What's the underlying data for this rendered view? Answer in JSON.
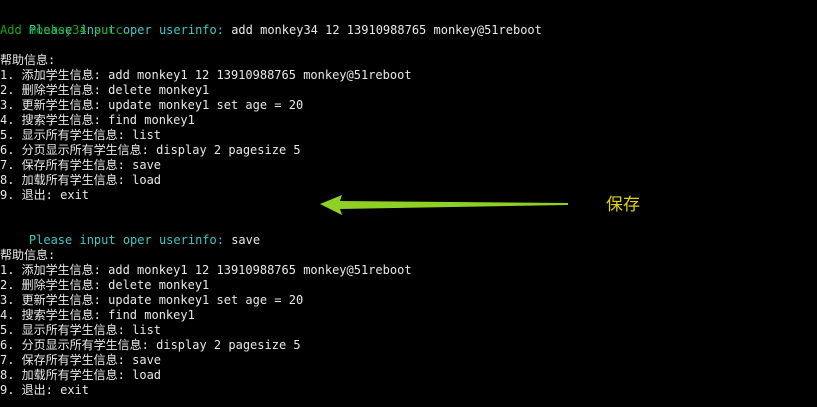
{
  "colors": {
    "background": "#000000",
    "text": "#e8e8e8",
    "prompt": "#3fc7c7",
    "success": "#17a317",
    "annotation": "#e0d500",
    "arrow": "#8ed024"
  },
  "session1": {
    "prompt": "Please input oper userinfo:",
    "command": " add monkey34 12 13910988765 monkey@51reboot",
    "result": "Add monkey34 succ."
  },
  "help_block_1": {
    "header": "帮助信息:",
    "items": [
      "1. 添加学生信息: add monkey1 12 13910988765 monkey@51reboot",
      "2. 删除学生信息: delete monkey1",
      "3. 更新学生信息: update monkey1 set age = 20",
      "4. 搜索学生信息: find monkey1",
      "5. 显示所有学生信息: list",
      "6. 分页显示所有学生信息: display 2 pagesize 5",
      "7. 保存所有学生信息: save",
      "8. 加载所有学生信息: load",
      "9. 退出: exit"
    ]
  },
  "session2": {
    "prompt": "Please input oper userinfo:",
    "command": " save"
  },
  "help_block_2": {
    "header": "帮助信息:",
    "items": [
      "1. 添加学生信息: add monkey1 12 13910988765 monkey@51reboot",
      "2. 删除学生信息: delete monkey1",
      "3. 更新学生信息: update monkey1 set age = 20",
      "4. 搜索学生信息: find monkey1",
      "5. 显示所有学生信息: list",
      "6. 分页显示所有学生信息: display 2 pagesize 5",
      "7. 保存所有学生信息: save",
      "8. 加载所有学生信息: load",
      "9. 退出: exit"
    ]
  },
  "annotation": {
    "label": "保存",
    "icon": "arrow-left-icon"
  }
}
